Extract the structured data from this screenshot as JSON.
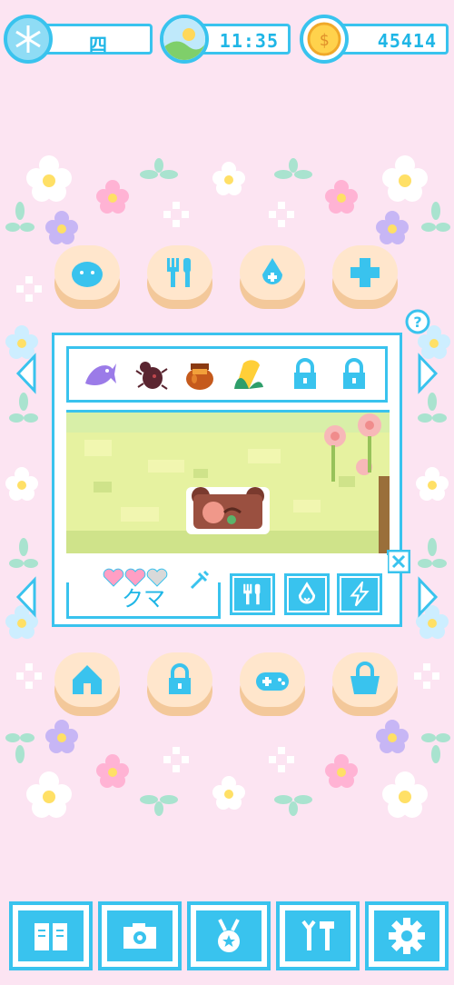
{
  "status_bar": {
    "weather_icon": "snowflake-icon",
    "day_value": "四",
    "time_icon": "landscape-icon",
    "time_value": "11:35",
    "coin_icon": "coin-icon",
    "coins_value": "45414"
  },
  "action_buttons_top": [
    {
      "name": "bubble-button",
      "icon": "blob-icon"
    },
    {
      "name": "feed-button",
      "icon": "fork-knife-icon"
    },
    {
      "name": "water-button",
      "icon": "water-drop-icon"
    },
    {
      "name": "heal-button",
      "icon": "plus-icon"
    }
  ],
  "food_items": [
    {
      "name": "fish",
      "icon": "fish-icon",
      "locked": false
    },
    {
      "name": "beetle",
      "icon": "beetle-icon",
      "locked": false
    },
    {
      "name": "honey",
      "icon": "honey-pot-icon",
      "locked": false
    },
    {
      "name": "corn",
      "icon": "corn-icon",
      "locked": false
    },
    {
      "name": "locked-1",
      "icon": "lock-icon",
      "locked": true
    },
    {
      "name": "locked-2",
      "icon": "lock-icon",
      "locked": true
    }
  ],
  "pet": {
    "name": "クマ",
    "hearts_full": 2,
    "hearts_total": 3,
    "help_icon": "question-icon",
    "close_icon": "close-icon"
  },
  "pet_actions": [
    {
      "name": "feed-status",
      "icon": "fork-knife-icon"
    },
    {
      "name": "water-status",
      "icon": "water-drop-icon"
    },
    {
      "name": "energy-status",
      "icon": "lightning-icon"
    }
  ],
  "action_buttons_bottom": [
    {
      "name": "home-button",
      "icon": "house-icon"
    },
    {
      "name": "locked-button",
      "icon": "lock-icon"
    },
    {
      "name": "play-button",
      "icon": "gamepad-icon"
    },
    {
      "name": "shop-button",
      "icon": "basket-icon"
    }
  ],
  "bottom_nav": [
    {
      "name": "journal",
      "icon": "book-icon"
    },
    {
      "name": "camera",
      "icon": "camera-icon"
    },
    {
      "name": "medal",
      "icon": "medal-icon"
    },
    {
      "name": "tools",
      "icon": "tools-icon"
    },
    {
      "name": "settings",
      "icon": "gear-icon"
    }
  ],
  "colors": {
    "background": "#fce4f2",
    "accent": "#39c3ee",
    "button_top": "#ffe6cc",
    "button_base": "#f3c89a",
    "heart": "#ff9fc4"
  }
}
